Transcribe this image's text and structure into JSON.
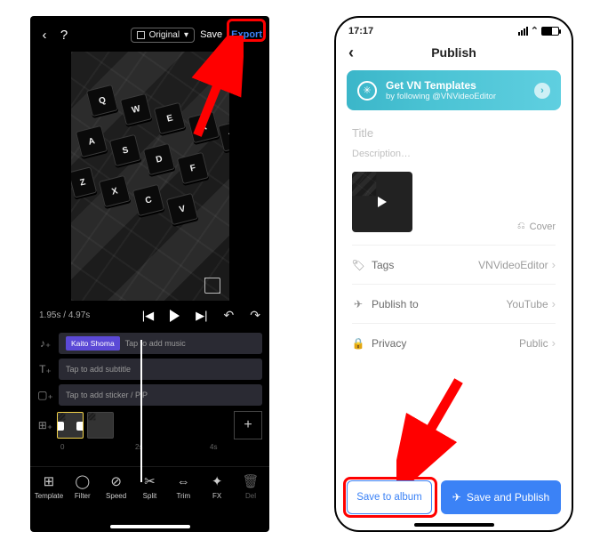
{
  "left": {
    "topbar": {
      "aspect_label": "Original",
      "save": "Save",
      "export": "Export"
    },
    "preview_keys": [
      "Q",
      "W",
      "E",
      "R",
      "T",
      "A",
      "S",
      "D",
      "F",
      "Z",
      "X",
      "C",
      "V"
    ],
    "time": {
      "current": "1.95s",
      "total": "4.97s"
    },
    "tracks": {
      "music_clip": "Kaito Shoma",
      "music_hint": "Tap to add music",
      "subtitle_hint": "Tap to add subtitle",
      "sticker_hint": "Tap to add sticker / PiP"
    },
    "ruler": {
      "t0": "0",
      "t1": "2s",
      "t2": "4s"
    },
    "tools": [
      {
        "name": "template",
        "label": "Template",
        "glyph": "⊞"
      },
      {
        "name": "filter",
        "label": "Filter",
        "glyph": "◯"
      },
      {
        "name": "speed",
        "label": "Speed",
        "glyph": "⊘"
      },
      {
        "name": "split",
        "label": "Split",
        "glyph": "✂"
      },
      {
        "name": "trim",
        "label": "Trim",
        "glyph": "⇔"
      },
      {
        "name": "fx",
        "label": "FX",
        "glyph": "✦"
      },
      {
        "name": "delete",
        "label": "Del",
        "glyph": "🗑"
      }
    ]
  },
  "right": {
    "status": {
      "time": "17:17"
    },
    "title": "Publish",
    "banner": {
      "line1": "Get VN Templates",
      "line2": "by following @VNVideoEditor"
    },
    "form": {
      "title_ph": "Title",
      "desc_ph": "Description…",
      "cover_label": "Cover"
    },
    "rows": {
      "tags": {
        "label": "Tags",
        "value": "VNVideoEditor"
      },
      "publish_to": {
        "label": "Publish to",
        "value": "YouTube"
      },
      "privacy": {
        "label": "Privacy",
        "value": "Public"
      }
    },
    "actions": {
      "save": "Save to album",
      "publish": "Save and Publish"
    }
  }
}
